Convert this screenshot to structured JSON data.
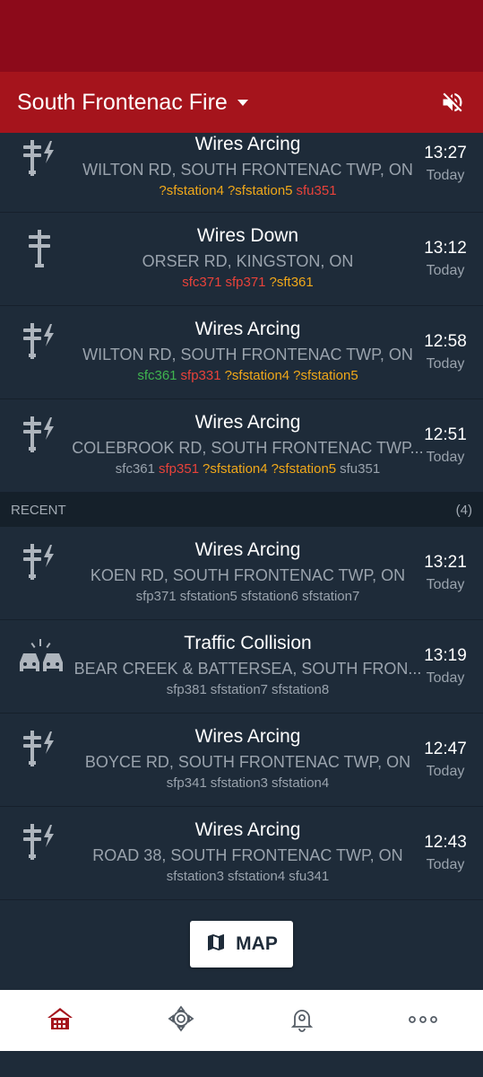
{
  "app": {
    "title": "South Frontenac Fire",
    "mute_icon": "volume-off-icon"
  },
  "colors": {
    "accent_red": "#a5141c",
    "status_red": "#8c0a1a",
    "unit_orange": "#f0a81a",
    "unit_red": "#e8423a",
    "unit_green": "#3fb44f",
    "unit_gray": "#9aa3ad"
  },
  "active": [
    {
      "icon": "wires-arcing-icon",
      "title": "Wires Arcing",
      "address": "WILTON RD, SOUTH FRONTENAC TWP, ON",
      "time": "13:27",
      "day": "Today",
      "units": [
        {
          "name": "?sfstation4",
          "color": "#f0a81a"
        },
        {
          "name": "?sfstation5",
          "color": "#f0a81a"
        },
        {
          "name": "sfu351",
          "color": "#e8423a"
        }
      ]
    },
    {
      "icon": "wires-down-icon",
      "title": "Wires Down",
      "address": "ORSER RD, KINGSTON, ON",
      "time": "13:12",
      "day": "Today",
      "units": [
        {
          "name": "sfc371",
          "color": "#e8423a"
        },
        {
          "name": "sfp371",
          "color": "#e8423a"
        },
        {
          "name": "?sft361",
          "color": "#f0a81a"
        }
      ]
    },
    {
      "icon": "wires-arcing-icon",
      "title": "Wires Arcing",
      "address": "WILTON RD, SOUTH FRONTENAC TWP, ON",
      "time": "12:58",
      "day": "Today",
      "units": [
        {
          "name": "sfc361",
          "color": "#3fb44f"
        },
        {
          "name": "sfp331",
          "color": "#e8423a"
        },
        {
          "name": "?sfstation4",
          "color": "#f0a81a"
        },
        {
          "name": "?sfstation5",
          "color": "#f0a81a"
        }
      ]
    },
    {
      "icon": "wires-arcing-icon",
      "title": "Wires Arcing",
      "address": "COLEBROOK RD, SOUTH FRONTENAC TWP...",
      "time": "12:51",
      "day": "Today",
      "units": [
        {
          "name": "sfc361",
          "color": "#9aa3ad"
        },
        {
          "name": "sfp351",
          "color": "#e8423a"
        },
        {
          "name": "?sfstation4",
          "color": "#f0a81a"
        },
        {
          "name": "?sfstation5",
          "color": "#f0a81a"
        },
        {
          "name": "sfu351",
          "color": "#9aa3ad"
        }
      ]
    }
  ],
  "recent_header": {
    "label": "RECENT",
    "count": "(4)"
  },
  "recent": [
    {
      "icon": "wires-arcing-icon",
      "title": "Wires Arcing",
      "address": "KOEN RD, SOUTH FRONTENAC TWP, ON",
      "time": "13:21",
      "day": "Today",
      "units": [
        {
          "name": "sfp371",
          "color": "#9aa3ad"
        },
        {
          "name": "sfstation5",
          "color": "#9aa3ad"
        },
        {
          "name": "sfstation6",
          "color": "#9aa3ad"
        },
        {
          "name": "sfstation7",
          "color": "#9aa3ad"
        }
      ]
    },
    {
      "icon": "traffic-collision-icon",
      "title": "Traffic Collision",
      "address": "BEAR CREEK & BATTERSEA, SOUTH FRON...",
      "time": "13:19",
      "day": "Today",
      "units": [
        {
          "name": "sfp381",
          "color": "#9aa3ad"
        },
        {
          "name": "sfstation7",
          "color": "#9aa3ad"
        },
        {
          "name": "sfstation8",
          "color": "#9aa3ad"
        }
      ]
    },
    {
      "icon": "wires-arcing-icon",
      "title": "Wires Arcing",
      "address": "BOYCE RD, SOUTH FRONTENAC TWP, ON",
      "time": "12:47",
      "day": "Today",
      "units": [
        {
          "name": "sfp341",
          "color": "#9aa3ad"
        },
        {
          "name": "sfstation3",
          "color": "#9aa3ad"
        },
        {
          "name": "sfstation4",
          "color": "#9aa3ad"
        }
      ]
    },
    {
      "icon": "wires-arcing-icon",
      "title": "Wires Arcing",
      "address": "ROAD 38, SOUTH FRONTENAC TWP, ON",
      "time": "12:43",
      "day": "Today",
      "units": [
        {
          "name": "sfstation3",
          "color": "#9aa3ad"
        },
        {
          "name": "sfstation4",
          "color": "#9aa3ad"
        },
        {
          "name": "sfu341",
          "color": "#9aa3ad"
        }
      ]
    }
  ],
  "map_button": {
    "label": "MAP",
    "icon": "map-icon"
  },
  "bottom_nav": [
    {
      "icon": "home-icon",
      "active": true
    },
    {
      "icon": "fire-department-icon",
      "active": false
    },
    {
      "icon": "alert-settings-icon",
      "active": false
    },
    {
      "icon": "more-icon",
      "active": false
    }
  ]
}
